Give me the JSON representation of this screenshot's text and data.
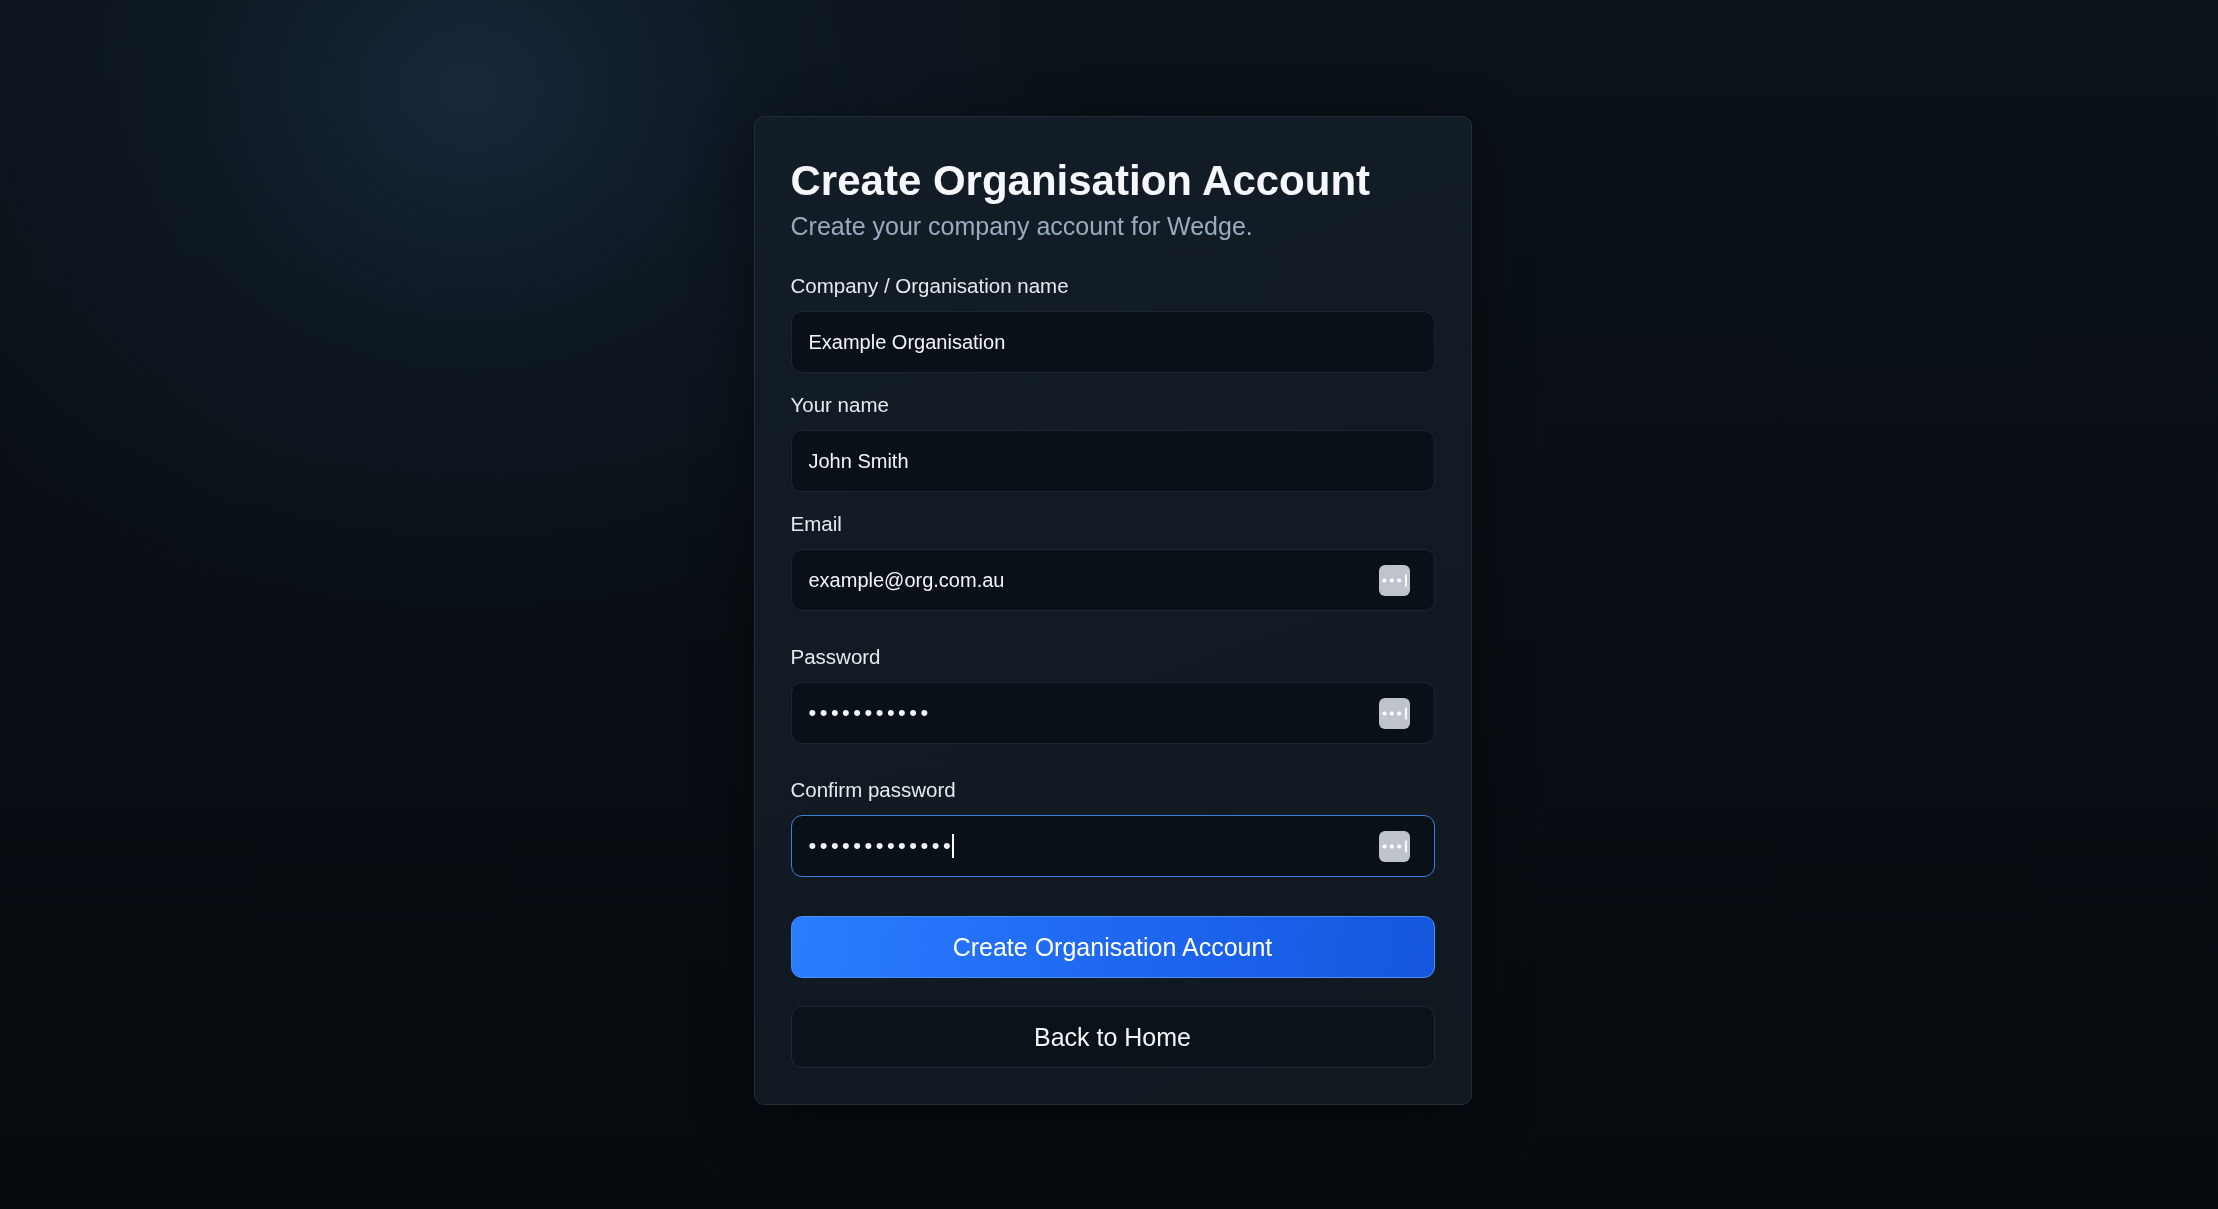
{
  "card": {
    "title": "Create Organisation Account",
    "subtitle": "Create your company account for Wedge."
  },
  "fields": [
    {
      "label": "Company / Organisation name",
      "value": "Example Organisation",
      "kind": "text",
      "autofill_icon": false,
      "focused": false
    },
    {
      "label": "Your name",
      "value": "John Smith",
      "kind": "text",
      "autofill_icon": false,
      "focused": false
    },
    {
      "label": "Email",
      "value": "example@org.com.au",
      "kind": "email",
      "autofill_icon": true,
      "focused": false
    },
    {
      "label": "Password",
      "value": "•••••••••••",
      "kind": "password",
      "autofill_icon": true,
      "focused": false
    },
    {
      "label": "Confirm password",
      "value": "•••••••••••••",
      "kind": "password",
      "autofill_icon": true,
      "focused": true
    }
  ],
  "buttons": [
    {
      "label": "Create Organisation Account",
      "kind": "primary"
    },
    {
      "label": "Back to Home",
      "kind": "secondary"
    }
  ]
}
